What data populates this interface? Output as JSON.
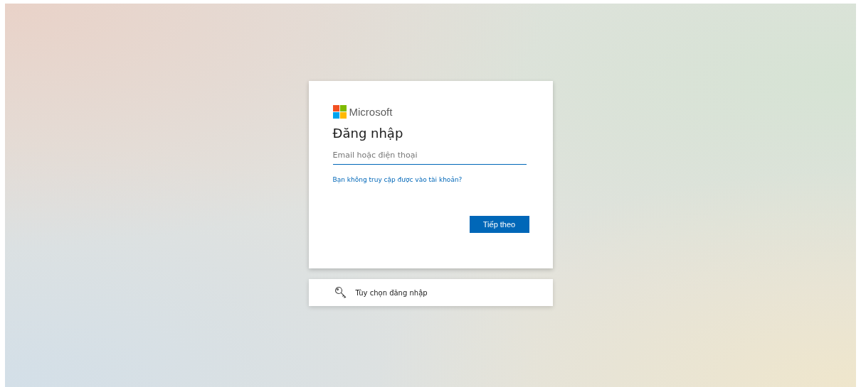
{
  "brand": {
    "name": "Microsoft"
  },
  "sign_in": {
    "title": "Đăng nhập",
    "email_field": {
      "placeholder": "Email hoặc điện thoại"
    },
    "help_link": "Bạn không truy cập được vào tài khoản?",
    "next_button": "Tiếp theo"
  },
  "options": {
    "label": "Tùy chọn đăng nhập"
  }
}
